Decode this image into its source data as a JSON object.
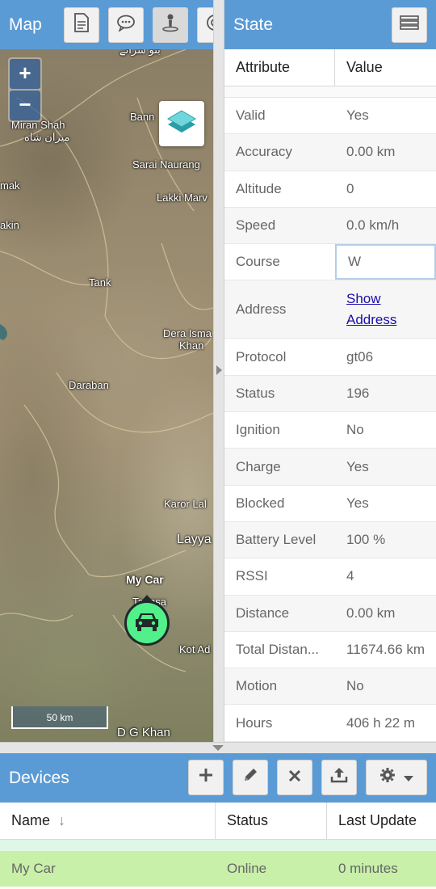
{
  "map": {
    "title": "Map",
    "toolbar": [
      "report-icon",
      "chat-icon",
      "person-pin-icon",
      "target-icon"
    ],
    "zoom_in": "+",
    "zoom_out": "−",
    "places": {
      "bannu": "Bann",
      "miranshah": "Miran Shah",
      "sarai": "Sarai Naurang",
      "lakki": "Lakki Marv",
      "tank": "Tank",
      "dera": "Dera Isma",
      "khan": "Khan",
      "daraban": "Daraban",
      "karor": "Karor Lal",
      "layya": "Layya",
      "kotad": "Kot Ad",
      "taunsa": "Taunsa",
      "mak": "mak",
      "akin": "akin",
      "dgkhan": "D G Khan"
    },
    "scale_label": "50 km",
    "device_label": "My Car"
  },
  "state": {
    "title": "State",
    "col_attribute": "Attribute",
    "col_value": "Value",
    "rows": [
      {
        "attr": "Valid",
        "value": "Yes"
      },
      {
        "attr": "Accuracy",
        "value": "0.00 km"
      },
      {
        "attr": "Altitude",
        "value": "0"
      },
      {
        "attr": "Speed",
        "value": "0.0 km/h"
      },
      {
        "attr": "Course",
        "value": "W"
      },
      {
        "attr": "Address",
        "link_line1": "Show",
        "link_line2": "Address"
      },
      {
        "attr": "Protocol",
        "value": "gt06"
      },
      {
        "attr": "Status",
        "value": "196"
      },
      {
        "attr": "Ignition",
        "value": "No"
      },
      {
        "attr": "Charge",
        "value": "Yes"
      },
      {
        "attr": "Blocked",
        "value": "Yes"
      },
      {
        "attr": "Battery Level",
        "value": "100 %"
      },
      {
        "attr": "RSSI",
        "value": "4"
      },
      {
        "attr": "Distance",
        "value": "0.00 km"
      },
      {
        "attr": "Total Distan...",
        "value": "11674.66 km"
      },
      {
        "attr": "Motion",
        "value": "No"
      },
      {
        "attr": "Hours",
        "value": "406 h 22 m"
      }
    ]
  },
  "devices": {
    "title": "Devices",
    "col_name": "Name",
    "col_status": "Status",
    "col_last_update": "Last Update",
    "rows": [
      {
        "name": "My Car",
        "status": "Online",
        "last_update": "0 minutes"
      }
    ]
  },
  "colors": {
    "header": "#5b9bd5",
    "selected_row": "#c8f0a9",
    "marker": "#52f08a"
  }
}
